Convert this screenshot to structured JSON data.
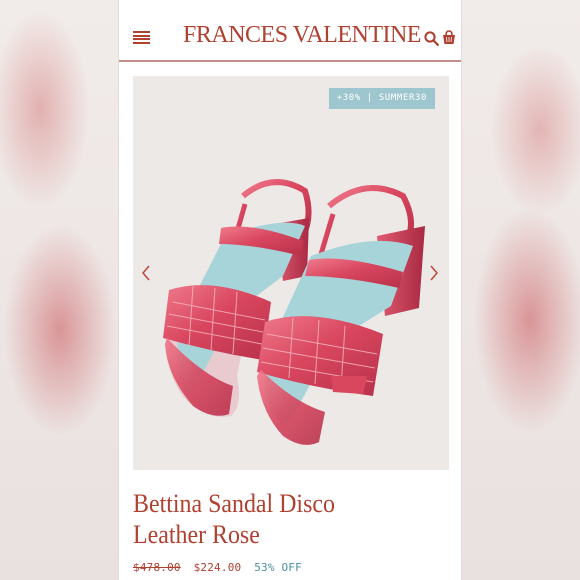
{
  "header": {
    "brand": "FRANCES VALENTINE",
    "menu_icon": "hamburger-menu-icon",
    "search_icon": "search-icon",
    "cart_icon": "shopping-bag-icon"
  },
  "product": {
    "promo_badge": "+30% | SUMMER30",
    "title": "Bettina Sandal Disco Leather Rose",
    "price_original": "$478.00",
    "price_sale": "$224.00",
    "discount": "53% OFF"
  },
  "colors": {
    "brand": "#b0402f",
    "badge": "#9ec6cf",
    "discount": "#4a8fa0",
    "sandal": "#d9475f"
  }
}
